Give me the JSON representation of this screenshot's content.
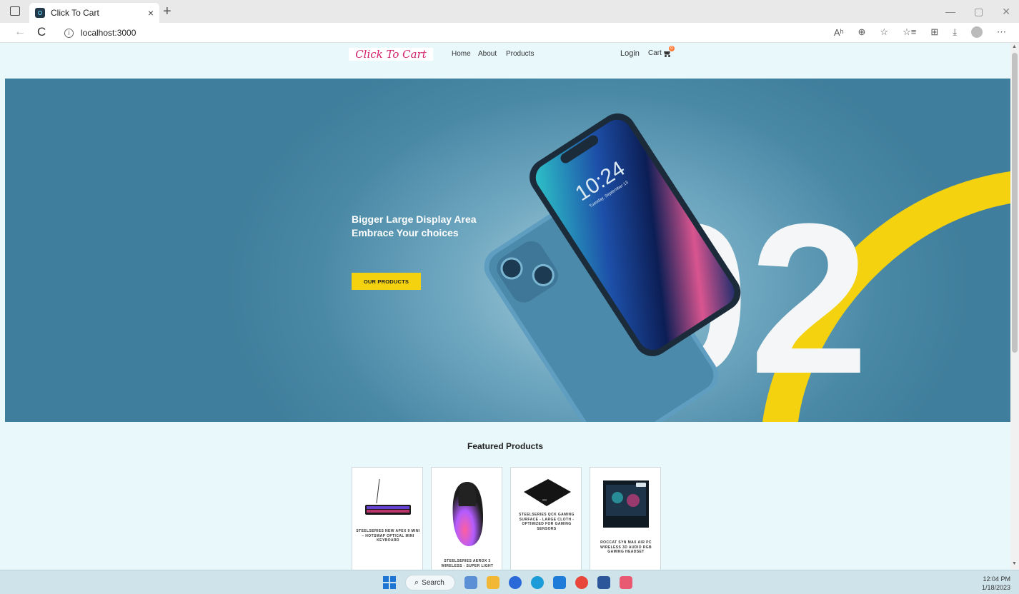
{
  "browser": {
    "tab_title": "Click To Cart",
    "url": "localhost:3000",
    "close_glyph": "×",
    "new_tab_glyph": "+",
    "back_glyph": "←",
    "reload_glyph": "C",
    "info_glyph": "i",
    "window_controls": [
      "—",
      "▢",
      "✕"
    ],
    "toolbar_glyphs": [
      "Aʰ",
      "⊕",
      "☆",
      "☆≡",
      "⊞",
      "⤓",
      "⋯"
    ]
  },
  "site": {
    "brand": "Click To Cart",
    "nav": {
      "home": "Home",
      "about": "About",
      "products": "Products",
      "login": "Login",
      "cart": "Cart",
      "cart_count": "0"
    }
  },
  "hero": {
    "title_line1": "Bigger Large Display Area",
    "title_line2": "Embrace Your choices",
    "button": "OUR PRODUCTS",
    "phone_time": "10:24",
    "phone_date": "Tuesday, September 13",
    "number": "02",
    "accent_color": "#f5d20f"
  },
  "featured": {
    "title": "Featured Products",
    "products": [
      {
        "name": "STEELSERIES NEW APEX 9 MINI – HOTSWAP OPTICAL MINI KEYBOARD",
        "icon": "keyboard-image"
      },
      {
        "name": "STEELSERIES AEROX 3 WIRELESS - SUPER LIGHT",
        "icon": "mouse-image"
      },
      {
        "name": "STEELSERIES QCK GAMING SURFACE - LARGE CLOTH - OPTIMIZED FOR GAMING SENSORS",
        "icon": "mousepad-image"
      },
      {
        "name": "ROCCAT SYN MAX AIR PC WIRELESS 3D AUDIO RGB GAMING HEADSET",
        "icon": "headset-box-image"
      }
    ]
  },
  "taskbar": {
    "search": "Search",
    "search_glyph": "⌕",
    "time": "12:04 PM",
    "date": "1/18/2023"
  }
}
